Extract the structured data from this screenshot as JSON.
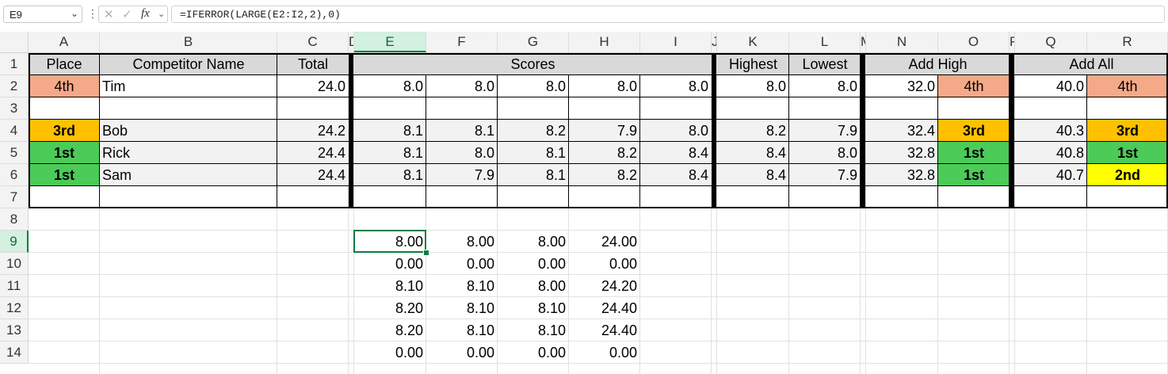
{
  "formula_bar": {
    "name_box": "E9",
    "fx_label": "fx",
    "formula": "=IFERROR(LARGE(E2:I2,2),0)"
  },
  "colors": {
    "rank_4th": "#f4a988",
    "rank_3rd": "#ffc000",
    "rank_2nd": "#ffff00",
    "rank_1st": "#4ccb58",
    "header_fill": "#d9d9d9",
    "accent": "#107c41"
  },
  "columns": [
    "A",
    "B",
    "C",
    "D",
    "E",
    "F",
    "G",
    "H",
    "I",
    "J",
    "K",
    "L",
    "M",
    "N",
    "O",
    "P",
    "Q",
    "R"
  ],
  "rows": [
    "1",
    "2",
    "3",
    "4",
    "5",
    "6",
    "7",
    "8",
    "9",
    "10",
    "11",
    "12",
    "13",
    "14"
  ],
  "selected": {
    "column": "E",
    "row": "9"
  },
  "table": {
    "headers": {
      "place": "Place",
      "name": "Competitor Name",
      "total": "Total",
      "scores": "Scores",
      "highest": "Highest",
      "lowest": "Lowest",
      "add_high": "Add High",
      "add_all": "Add All"
    },
    "rows": [
      {
        "row": 2,
        "place": "4th",
        "name": "Tim",
        "total": "24.0",
        "scores": [
          "8.0",
          "8.0",
          "8.0",
          "8.0",
          "8.0"
        ],
        "highest": "8.0",
        "lowest": "8.0",
        "add_high": "32.0",
        "add_high_rank": "4th",
        "add_all": "40.0",
        "add_all_rank": "4th"
      },
      {
        "row": 4,
        "place": "3rd",
        "name": "Bob",
        "total": "24.2",
        "scores": [
          "8.1",
          "8.1",
          "8.2",
          "7.9",
          "8.0"
        ],
        "highest": "8.2",
        "lowest": "7.9",
        "add_high": "32.4",
        "add_high_rank": "3rd",
        "add_all": "40.3",
        "add_all_rank": "3rd"
      },
      {
        "row": 5,
        "place": "1st",
        "name": "Rick",
        "total": "24.4",
        "scores": [
          "8.1",
          "8.0",
          "8.1",
          "8.2",
          "8.4"
        ],
        "highest": "8.4",
        "lowest": "8.0",
        "add_high": "32.8",
        "add_high_rank": "1st",
        "add_all": "40.8",
        "add_all_rank": "1st"
      },
      {
        "row": 6,
        "place": "1st",
        "name": "Sam",
        "total": "24.4",
        "scores": [
          "8.1",
          "7.9",
          "8.1",
          "8.2",
          "8.4"
        ],
        "highest": "8.4",
        "lowest": "7.9",
        "add_high": "32.8",
        "add_high_rank": "1st",
        "add_all": "40.7",
        "add_all_rank": "2nd"
      }
    ]
  },
  "calc": [
    [
      "8.00",
      "8.00",
      "8.00",
      "24.00"
    ],
    [
      "0.00",
      "0.00",
      "0.00",
      "0.00"
    ],
    [
      "8.10",
      "8.10",
      "8.00",
      "24.20"
    ],
    [
      "8.20",
      "8.10",
      "8.10",
      "24.40"
    ],
    [
      "8.20",
      "8.10",
      "8.10",
      "24.40"
    ],
    [
      "0.00",
      "0.00",
      "0.00",
      "0.00"
    ]
  ]
}
